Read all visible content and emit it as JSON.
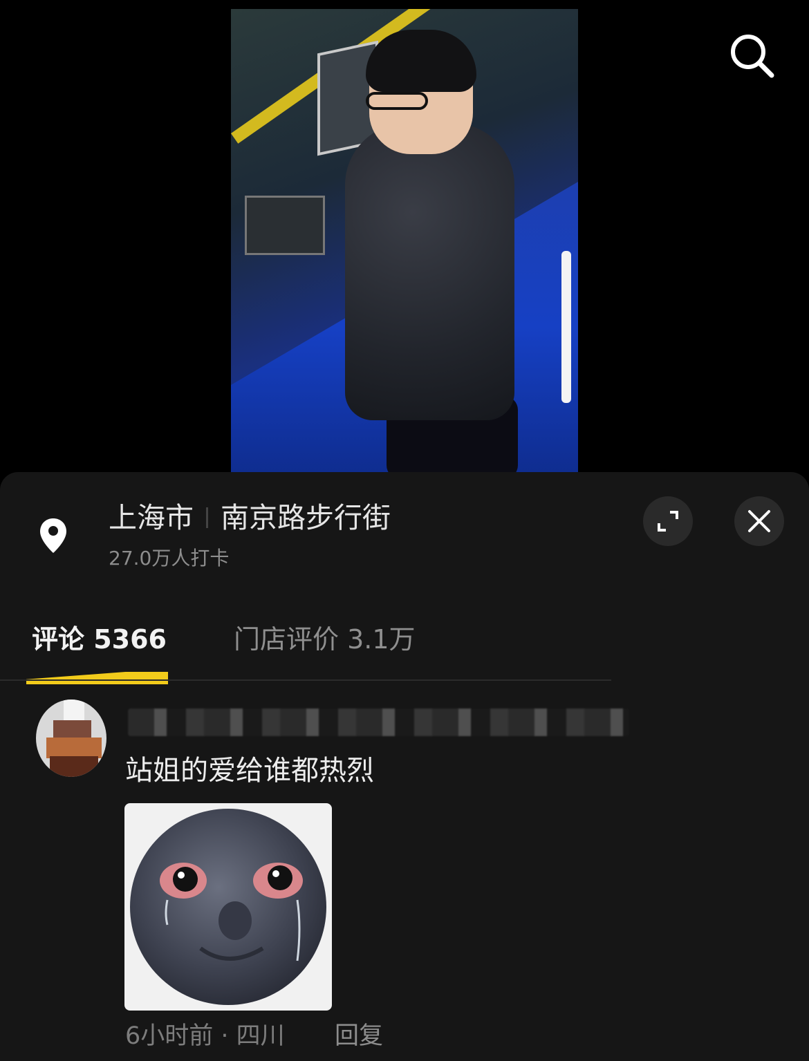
{
  "location": {
    "city": "上海市",
    "place": "南京路步行街",
    "checkins": "27.0万人打卡"
  },
  "tabs": [
    {
      "label": "评论 5366",
      "active": true
    },
    {
      "label": "门店评价 3.1万",
      "active": false
    }
  ],
  "comment": {
    "text": "站姐的爱给谁都热烈",
    "time_region": "6小时前 · 四川",
    "reply_label": "回复"
  },
  "icons": {
    "search": "search-icon",
    "location": "location-pin-icon",
    "expand": "expand-icon",
    "close": "close-icon"
  },
  "colors": {
    "accent": "#f2cb1b",
    "sheet_bg": "#161616",
    "page_bg": "#000000"
  }
}
